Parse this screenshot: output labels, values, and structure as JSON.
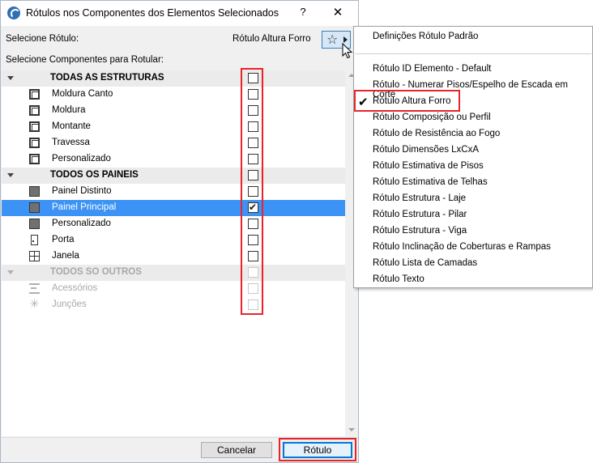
{
  "window": {
    "title": "Rótulos nos Componentes dos Elementos Selecionados",
    "help": "?",
    "close": "✕"
  },
  "label_select": {
    "label": "Selecione Rótulo:",
    "current": "Rótulo Altura Forro",
    "star_icon": "star-icon"
  },
  "components_label": "Selecione Componentes para Rotular:",
  "tree": [
    {
      "type": "group",
      "label": "TODAS AS ESTRUTURAS",
      "checked": false,
      "disabled": false
    },
    {
      "type": "item",
      "label": "Moldura Canto",
      "icon": "frame-icon",
      "checked": false,
      "disabled": false
    },
    {
      "type": "item",
      "label": "Moldura",
      "icon": "frame-icon",
      "checked": false,
      "disabled": false
    },
    {
      "type": "item",
      "label": "Montante",
      "icon": "frame-icon",
      "checked": false,
      "disabled": false
    },
    {
      "type": "item",
      "label": "Travessa",
      "icon": "frame-icon",
      "checked": false,
      "disabled": false
    },
    {
      "type": "item",
      "label": "Personalizado",
      "icon": "frame-icon",
      "checked": false,
      "disabled": false
    },
    {
      "type": "group",
      "label": "TODOS OS PAINEIS",
      "checked": false,
      "disabled": false
    },
    {
      "type": "item",
      "label": "Painel Distinto",
      "icon": "panel-icon",
      "checked": false,
      "disabled": false
    },
    {
      "type": "item",
      "label": "Painel Principal",
      "icon": "panel-icon",
      "checked": true,
      "disabled": false,
      "selected": true
    },
    {
      "type": "item",
      "label": "Personalizado",
      "icon": "panel-icon",
      "checked": false,
      "disabled": false
    },
    {
      "type": "item",
      "label": "Porta",
      "icon": "door-icon",
      "checked": false,
      "disabled": false
    },
    {
      "type": "item",
      "label": "Janela",
      "icon": "window-icon",
      "checked": false,
      "disabled": false
    },
    {
      "type": "group",
      "label": "TODOS SO OUTROS",
      "checked": false,
      "disabled": true
    },
    {
      "type": "item",
      "label": "Acessórios",
      "icon": "accessories-icon",
      "checked": false,
      "disabled": true
    },
    {
      "type": "item",
      "label": "Junções",
      "icon": "junctions-icon",
      "checked": false,
      "disabled": true
    }
  ],
  "buttons": {
    "cancel": "Cancelar",
    "ok": "Rótulo"
  },
  "menu": {
    "header": "Definições Rótulo Padrão",
    "items": [
      {
        "label": "Rótulo ID Elemento - Default",
        "checked": false
      },
      {
        "label": "Rótulo - Numerar Pisos/Espelho de Escada em Corte",
        "checked": false
      },
      {
        "label": "Rótulo Altura Forro",
        "checked": true
      },
      {
        "label": "Rótulo Composição ou Perfil",
        "checked": false
      },
      {
        "label": "Rótulo de Resistência ao Fogo",
        "checked": false
      },
      {
        "label": "Rótulo Dimensões LxCxA",
        "checked": false
      },
      {
        "label": "Rótulo Estimativa de Pisos",
        "checked": false
      },
      {
        "label": "Rótulo Estimativa de Telhas",
        "checked": false
      },
      {
        "label": "Rótulo Estrutura - Laje",
        "checked": false
      },
      {
        "label": "Rótulo Estrutura - Pilar",
        "checked": false
      },
      {
        "label": "Rótulo Estrutura - Viga",
        "checked": false
      },
      {
        "label": "Rótulo Inclinação de Coberturas e Rampas",
        "checked": false
      },
      {
        "label": "Rótulo Lista de Camadas",
        "checked": false
      },
      {
        "label": "Rótulo Texto",
        "checked": false
      }
    ]
  },
  "colors": {
    "selection": "#3c93f5",
    "highlight": "#e8242a",
    "group_background": "#ebebeb"
  }
}
